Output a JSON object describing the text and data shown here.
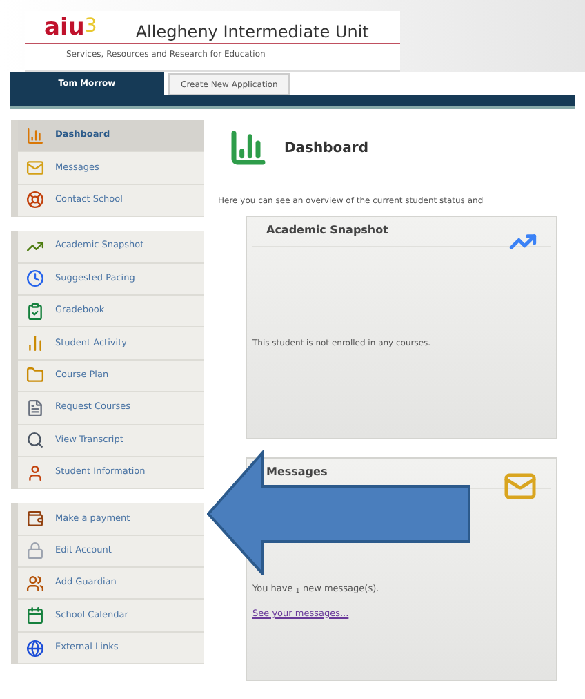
{
  "header": {
    "logo_letters": "aiu",
    "logo_mark": "3",
    "title": "Allegheny Intermediate Unit",
    "subtitle": "Services, Resources and Research for Education"
  },
  "tabs": [
    {
      "label": "Tom Morrow",
      "selected": true
    },
    {
      "label": "Create New Application",
      "selected": false
    }
  ],
  "sidebar": {
    "groups": [
      {
        "items": [
          {
            "label": "Dashboard",
            "selected": true
          },
          {
            "label": "Messages",
            "selected": false
          },
          {
            "label": "Contact School",
            "selected": false
          }
        ]
      },
      {
        "items": [
          {
            "label": "Academic Snapshot",
            "selected": false
          },
          {
            "label": "Suggested Pacing",
            "selected": false
          },
          {
            "label": "Gradebook",
            "selected": false
          },
          {
            "label": "Student Activity",
            "selected": false
          },
          {
            "label": "Course Plan",
            "selected": false
          },
          {
            "label": "Request Courses",
            "selected": false
          },
          {
            "label": "View Transcript",
            "selected": false
          },
          {
            "label": "Student Information",
            "selected": false
          }
        ]
      },
      {
        "items": [
          {
            "label": "Make a payment",
            "selected": false
          },
          {
            "label": "Edit Account",
            "selected": false
          },
          {
            "label": "Add Guardian",
            "selected": false
          },
          {
            "label": "School Calendar",
            "selected": false
          },
          {
            "label": "External Links",
            "selected": false
          }
        ]
      }
    ]
  },
  "page": {
    "title": "Dashboard",
    "intro": "Here you can see an overview of the current student status and"
  },
  "cards": [
    {
      "kind": "snapshot",
      "title": "Academic Snapshot",
      "body": "This student is not enrolled in any courses."
    },
    {
      "kind": "messages",
      "title": "Messages",
      "body": "You have $_{1}$ new message(s).",
      "link": "See your messages..."
    }
  ]
}
